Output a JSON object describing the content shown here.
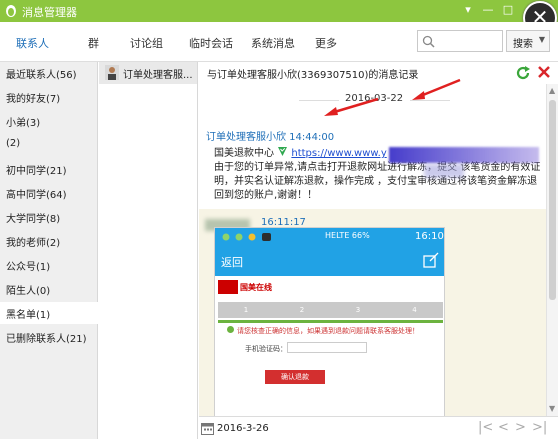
{
  "window": {
    "title": "消息管理器",
    "close_glyph": "✕"
  },
  "tabs": [
    {
      "label": "联系人",
      "active": true
    },
    {
      "label": "群"
    },
    {
      "label": "讨论组"
    },
    {
      "label": "临时会话"
    },
    {
      "label": "系统消息"
    },
    {
      "label": "更多"
    }
  ],
  "search": {
    "placeholder": "",
    "button_label": "搜索"
  },
  "sidebar": {
    "items": [
      {
        "label": "最近联系人(56)"
      },
      {
        "label": "我的好友(7)"
      },
      {
        "label": "小弟(3)"
      },
      {
        "label": "(2)"
      },
      {
        "label": "初中同学(21)"
      },
      {
        "label": "高中同学(64)"
      },
      {
        "label": "大学同学(8)"
      },
      {
        "label": "我的老师(2)"
      },
      {
        "label": "公众号(1)"
      },
      {
        "label": "陌生人(0)"
      },
      {
        "label": "黑名单(1)",
        "active": true
      },
      {
        "label": "已删除联系人(21)"
      }
    ]
  },
  "conversation_list": {
    "items": [
      {
        "label": "订单处理客服..."
      }
    ]
  },
  "chat": {
    "header_title": "与订单处理客服小欣(3369307510)的消息记录",
    "date_separator": "2016-03-22",
    "message1": {
      "sender": "订单处理客服小欣 14:44:00",
      "org": "国美退款中心",
      "link": "https://www.www.y",
      "body": "由于您的订单异常,请点击打开退款网址进行解冻，提交 该笔货金的有效证明，并实名认证解冻退款，操作完成 ，支付宝审核通过将该笔资金解冻退回到您的账户,谢谢！！"
    },
    "message2": {
      "time": "16:11:17"
    },
    "footer_date": "2016-3-26"
  },
  "phone_screenshot": {
    "signal_text": "HELTE 66%",
    "time": "16:10",
    "back_label": "返回",
    "brand": "国美在线",
    "steps": [
      "1",
      "2",
      "3",
      "4"
    ],
    "warning": "请您核查正确的信息，如果遇到退款问题请联系客服处理！",
    "field_label": "手机验证码：",
    "button": "确认退款"
  },
  "accent_colors": {
    "titlebar": "#8dc63f",
    "link": "#1f6fb8",
    "phone_header": "#21a2e5",
    "annotation_arrow": "#e02020"
  }
}
